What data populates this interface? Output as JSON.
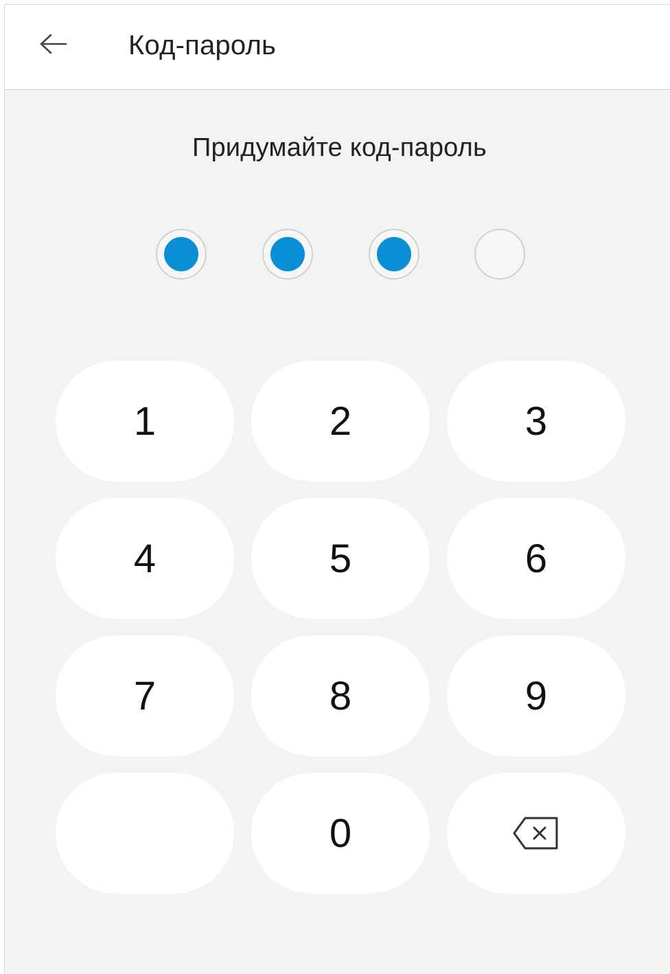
{
  "header": {
    "back_icon": "arrow-left-icon",
    "title": "Код-пароль"
  },
  "prompt": "Придумайте код-пароль",
  "passcode": {
    "length": 4,
    "entered": 3,
    "filled_color": "#0a8fd6"
  },
  "keypad": {
    "keys": [
      "1",
      "2",
      "3",
      "4",
      "5",
      "6",
      "7",
      "8",
      "9",
      "",
      "0",
      "backspace"
    ],
    "backspace_icon": "backspace-icon"
  }
}
